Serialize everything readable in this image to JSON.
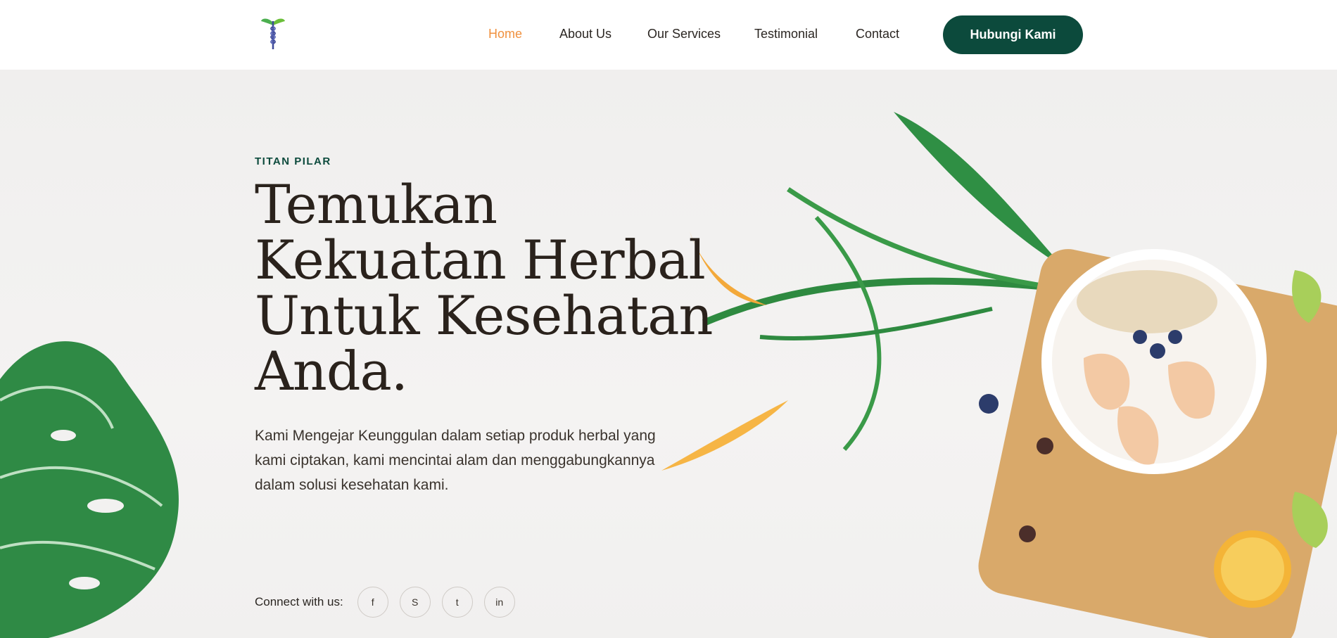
{
  "nav": {
    "items": [
      {
        "label": "Home",
        "active": true
      },
      {
        "label": "About Us",
        "active": false
      },
      {
        "label": "Our Services",
        "active": false
      },
      {
        "label": "Testimonial",
        "active": false
      },
      {
        "label": "Contact",
        "active": false
      }
    ],
    "cta_label": "Hubungi Kami"
  },
  "hero": {
    "eyebrow": "TITAN PILAR",
    "title": "Temukan Kekuatan Herbal Untuk Kesehatan Anda.",
    "description": "Kami Mengejar Keunggulan dalam setiap produk herbal yang kami ciptakan, kami mencintai alam dan menggabungkannya dalam solusi kesehatan kami.",
    "connect_label": "Connect with us:",
    "socials": [
      {
        "icon": "facebook-icon",
        "glyph": "f"
      },
      {
        "icon": "skype-icon",
        "glyph": "S"
      },
      {
        "icon": "twitter-icon",
        "glyph": "t"
      },
      {
        "icon": "linkedin-icon",
        "glyph": "in"
      }
    ]
  },
  "colors": {
    "brand_green": "#0c4a3c",
    "nav_active": "#f0913f",
    "text_dark": "#2a221c",
    "background": "#f2f1f0"
  }
}
